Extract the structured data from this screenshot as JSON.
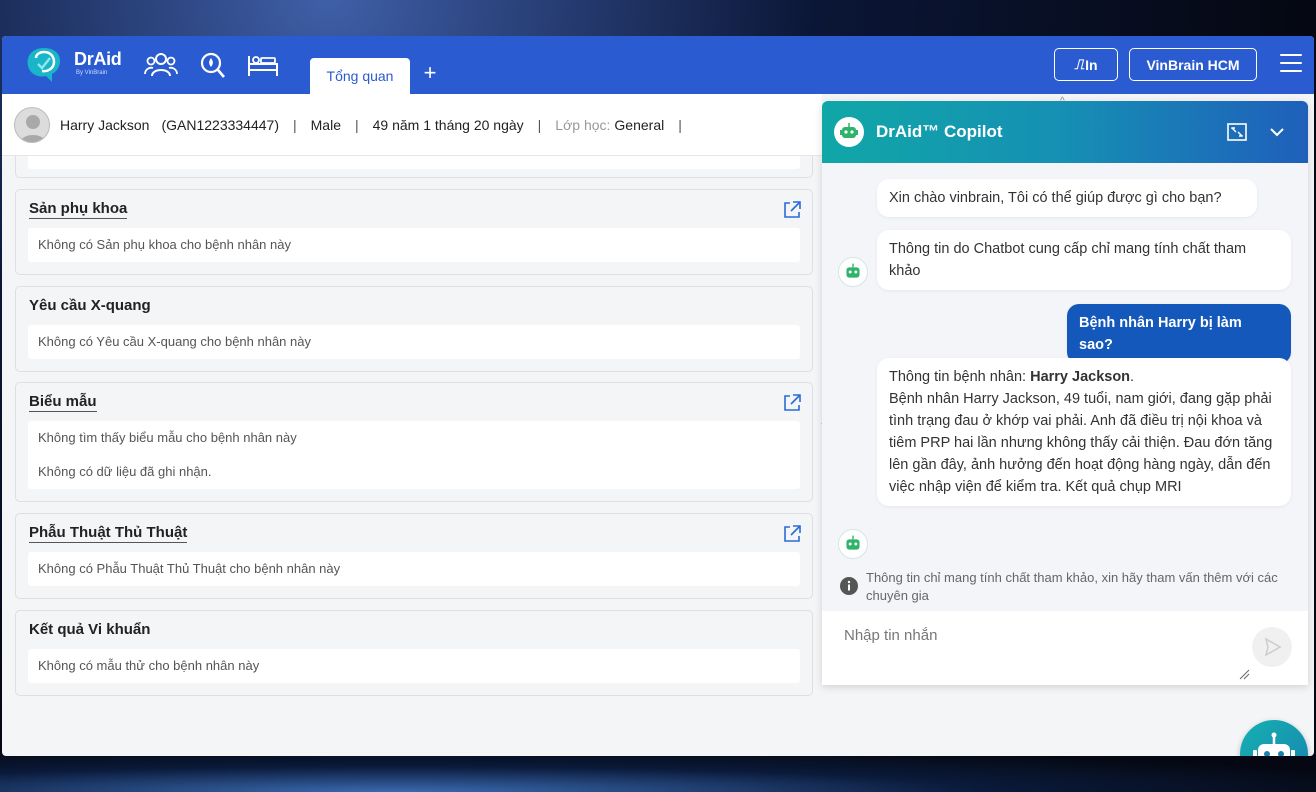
{
  "header": {
    "logo_text": "DrAid",
    "logo_sub": "By VinBrain",
    "icons": [
      "patients-icon",
      "search-icon",
      "bed-icon"
    ],
    "tabs": [
      {
        "label": "Tổng quan"
      }
    ],
    "add_tab": "+",
    "print_button": "In",
    "org_button": "VinBrain HCM"
  },
  "patient": {
    "name": "Harry Jackson",
    "id": "(GAN1223334447)",
    "sex": "Male",
    "age": "49 năm 1 tháng 20 ngày",
    "class_label": "Lớp học:",
    "class_value": "General",
    "sep": "|"
  },
  "cards": [
    {
      "title": "Sản phụ khoa",
      "lines": [
        "Không có Sản phụ khoa cho bệnh nhân này"
      ],
      "external": true
    },
    {
      "title": "Yêu cầu X-quang",
      "lines": [
        "Không có Yêu cầu X-quang cho bệnh nhân này"
      ],
      "external": false
    },
    {
      "title": "Biểu mẫu",
      "lines": [
        "Không tìm thấy biểu mẫu cho bệnh nhân này",
        "Không có dữ liệu đã ghi nhận."
      ],
      "external": true
    },
    {
      "title": "Phẫu Thuật Thủ Thuật",
      "lines": [
        "Không có Phẫu Thuật Thủ Thuật cho bệnh nhân này"
      ],
      "external": true
    },
    {
      "title": "Kết quả Vi khuẩn",
      "lines": [
        "Không có mẫu thử cho bệnh nhân này"
      ],
      "external": false
    }
  ],
  "chat": {
    "title": "DrAid™ Copilot",
    "messages": [
      {
        "role": "bot",
        "text": "Xin chào vinbrain, Tôi có thể giúp được gì cho bạn?"
      },
      {
        "role": "bot",
        "text": "Thông tin do Chatbot cung cấp chỉ mang tính chất tham khảo"
      },
      {
        "role": "user",
        "text": "Bệnh nhân Harry bị làm sao?"
      },
      {
        "role": "bot",
        "prefix": "Thông tin bệnh nhân: ",
        "bold": "Harry Jackson",
        "suffix": ".",
        "text": "Bệnh nhân Harry Jackson, 49 tuổi, nam giới, đang gặp phải tình trạng đau ở khớp vai phải. Anh đã điều trị nội khoa và tiêm PRP hai lần nhưng không thấy cải thiện. Đau đớn tăng lên gần đây, ảnh hưởng đến hoạt động hàng ngày, dẫn đến việc nhập viện để kiểm tra. Kết quả chụp MRI"
      }
    ],
    "disclaimer": "Thông tin chỉ mang tính chất tham khảo, xin hãy tham vấn thêm với các chuyên gia",
    "input_placeholder": "Nhập tin nhắn"
  },
  "colors": {
    "header": "#2a5bd0",
    "accent": "#1558bb",
    "chat_gradient_start": "#10a7a7",
    "chat_gradient_end": "#1f5fbb"
  }
}
